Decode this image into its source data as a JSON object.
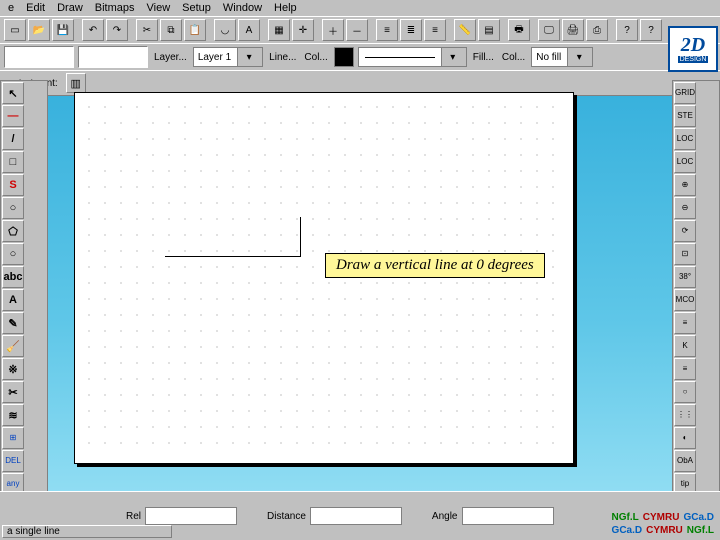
{
  "menu": {
    "items": [
      "e",
      "Edit",
      "Draw",
      "Bitmaps",
      "View",
      "Setup",
      "Window",
      "Help"
    ]
  },
  "toolbar_icons": [
    "new",
    "open",
    "save",
    "sep",
    "undo",
    "redo",
    "sep",
    "cut",
    "copy",
    "paste",
    "sep",
    "arc",
    "text",
    "sep",
    "grid",
    "snap",
    "sep",
    "zoom-in",
    "zoom-out",
    "sep",
    "align-l",
    "align-c",
    "align-r",
    "sep",
    "ruler",
    "layers",
    "sep",
    "print",
    "sep",
    "monitor",
    "printer2",
    "plotter",
    "sep",
    "help",
    "what"
  ],
  "props": {
    "layer_btn": "Layer...",
    "layer_combo": "Layer 1",
    "line_btn": "Line...",
    "col_btn": "Col...",
    "fill_btn": "Fill...",
    "col2_btn": "Col...",
    "nofill": "No fill"
  },
  "coord": {
    "label": "c start cont:"
  },
  "tools_left": [
    "↖",
    "—",
    "/",
    "□",
    "S",
    "○",
    "⬠",
    "○",
    "abc",
    "A",
    "✎",
    "🧹",
    "※",
    "✂",
    "≋",
    "⊞",
    "DEL",
    "any"
  ],
  "tools_right": [
    "GRID",
    "STE",
    "LOC",
    "LOC",
    "⊕",
    "⊖",
    "⟳",
    "⊡",
    "38°",
    "MCO",
    "≡",
    "K",
    "≡",
    "○",
    "⋮⋮",
    "◐",
    "ObA",
    "tip"
  ],
  "logo": {
    "big": "2D",
    "bar": "DESIGN"
  },
  "callout_text": "Draw a vertical line at 0 degrees",
  "status": {
    "rel": "Rel",
    "distance": "Distance",
    "angle": "Angle",
    "hint": "a single line"
  },
  "footer": {
    "ngfl": "NGf.L",
    "cymru": "CYMRU",
    "gcad": "GCa.D"
  }
}
